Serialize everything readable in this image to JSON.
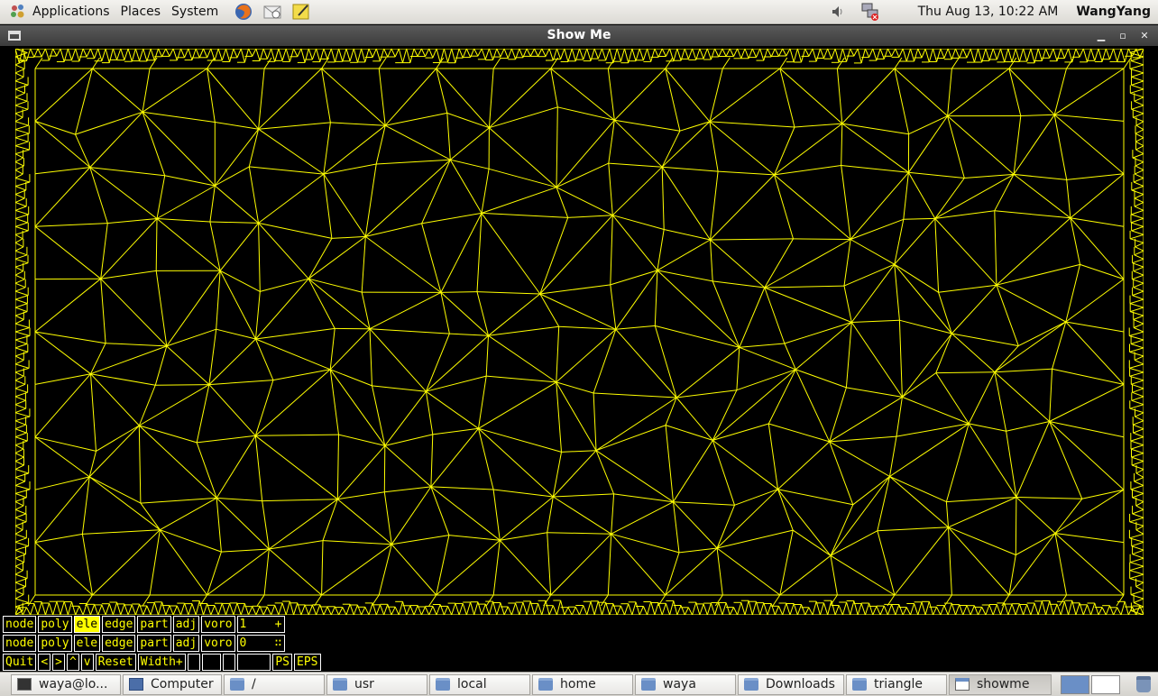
{
  "top_panel": {
    "menus": [
      "Applications",
      "Places",
      "System"
    ],
    "clock": "Thu Aug 13, 10:22 AM",
    "user": "WangYang",
    "launchers": [
      "firefox-icon",
      "mail-icon",
      "notes-icon"
    ]
  },
  "window": {
    "title": "Show Me"
  },
  "mesh": {
    "line_color": "#ffff00",
    "background": "#000000"
  },
  "showme": {
    "row1": [
      "node",
      "poly",
      "ele",
      "edge",
      "part",
      "adj",
      "voro",
      "1    +"
    ],
    "row1_active": "ele",
    "row2": [
      "node",
      "poly",
      "ele",
      "edge",
      "part",
      "adj",
      "voro",
      "0    ∷"
    ],
    "row3": [
      "Quit",
      "<",
      ">",
      "^",
      "v",
      "Reset",
      "Width+",
      " ",
      "  ",
      " ",
      "    ",
      "PS",
      "EPS"
    ]
  },
  "taskbar": {
    "tasks": [
      {
        "label": "waya@lo...",
        "icon": "terminal-icon"
      },
      {
        "label": "Computer",
        "icon": "computer-icon"
      },
      {
        "label": "/",
        "icon": "folder-icon"
      },
      {
        "label": "usr",
        "icon": "folder-icon"
      },
      {
        "label": "local",
        "icon": "folder-icon"
      },
      {
        "label": "home",
        "icon": "folder-icon"
      },
      {
        "label": "waya",
        "icon": "home-folder-icon"
      },
      {
        "label": "Downloads",
        "icon": "downloads-folder-icon"
      },
      {
        "label": "triangle",
        "icon": "folder-icon"
      },
      {
        "label": "showme",
        "icon": "window-icon",
        "active": true
      }
    ]
  }
}
